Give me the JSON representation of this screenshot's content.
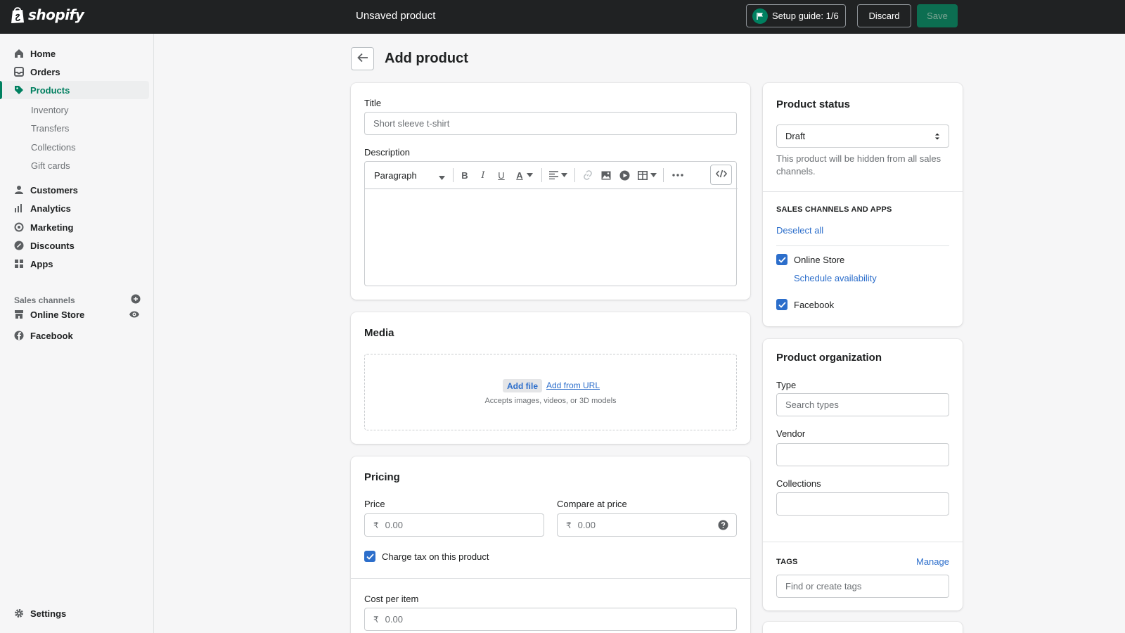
{
  "brand": {
    "name": "shopify",
    "accent": "#008060"
  },
  "topbar": {
    "title": "Unsaved product",
    "setup_guide": "Setup guide: 1/6",
    "discard": "Discard",
    "save": "Save"
  },
  "sidebar": {
    "items": [
      {
        "label": "Home",
        "icon": "home-icon"
      },
      {
        "label": "Orders",
        "icon": "orders-icon"
      },
      {
        "label": "Products",
        "icon": "tag-icon"
      },
      {
        "label": "Customers",
        "icon": "person-icon"
      },
      {
        "label": "Analytics",
        "icon": "bar-chart-icon"
      },
      {
        "label": "Marketing",
        "icon": "target-icon"
      },
      {
        "label": "Discounts",
        "icon": "discount-icon"
      },
      {
        "label": "Apps",
        "icon": "apps-icon"
      }
    ],
    "products_sub": [
      "Inventory",
      "Transfers",
      "Collections",
      "Gift cards"
    ],
    "sales_channels_heading": "Sales channels",
    "channels": [
      {
        "label": "Online Store",
        "icon": "store-icon"
      },
      {
        "label": "Facebook",
        "icon": "facebook-icon"
      }
    ],
    "settings": "Settings"
  },
  "page": {
    "title": "Add product"
  },
  "product_card": {
    "title_label": "Title",
    "title_placeholder": "Short sleeve t-shirt",
    "description_label": "Description",
    "paragraph_select": "Paragraph"
  },
  "media": {
    "title": "Media",
    "add_file": "Add file",
    "add_from_url": "Add from URL",
    "accepts": "Accepts images, videos, or 3D models"
  },
  "pricing": {
    "title": "Pricing",
    "price_label": "Price",
    "compare_label": "Compare at price",
    "currency": "₹",
    "price_placeholder": "0.00",
    "compare_placeholder": "0.00",
    "charge_tax": "Charge tax on this product",
    "cost_label": "Cost per item",
    "cost_placeholder": "0.00"
  },
  "status": {
    "title": "Product status",
    "value": "Draft",
    "helper": "This product will be hidden from all sales channels.",
    "sales_heading": "SALES CHANNELS AND APPS",
    "deselect_all": "Deselect all",
    "online_store": "Online Store",
    "schedule": "Schedule availability",
    "facebook": "Facebook"
  },
  "organization": {
    "title": "Product organization",
    "type_label": "Type",
    "type_placeholder": "Search types",
    "vendor_label": "Vendor",
    "collections_label": "Collections",
    "tags_heading": "TAGS",
    "manage": "Manage",
    "tags_placeholder": "Find or create tags"
  }
}
